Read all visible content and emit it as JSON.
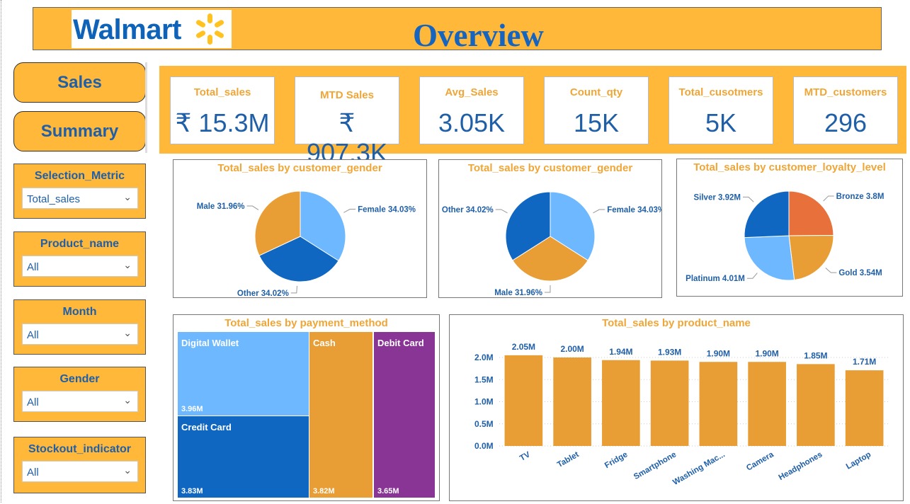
{
  "header": {
    "brand": "Walmart",
    "title": "Overview"
  },
  "nav": {
    "sales_label": "Sales",
    "summary_label": "Summary"
  },
  "slicers": [
    {
      "label": "Selection_Metric",
      "value": "Total_sales"
    },
    {
      "label": "Product_name",
      "value": "All"
    },
    {
      "label": "Month",
      "value": "All"
    },
    {
      "label": "Gender",
      "value": "All"
    },
    {
      "label": "Stockout_indicator",
      "value": "All"
    }
  ],
  "kpis": [
    {
      "label": "Total_sales",
      "value": "₹ 15.3M"
    },
    {
      "label": "MTD Sales",
      "value": "₹ 907.3K"
    },
    {
      "label": "Avg_Sales",
      "value": "3.05K"
    },
    {
      "label": "Count_qty",
      "value": "15K"
    },
    {
      "label": "Total_cusotmers",
      "value": "5K"
    },
    {
      "label": "MTD_customers",
      "value": "296"
    }
  ],
  "colors": {
    "accent": "#FFB83A",
    "brand_blue": "#1565C0",
    "title_orange": "#F0A637",
    "light_blue": "#6DB8FF",
    "dark_blue": "#0F67C2",
    "orange": "#E89D35",
    "purple": "#883596",
    "red_orange": "#E8703A"
  },
  "chart_data": [
    {
      "type": "pie",
      "title": "Total_sales by customer_gender",
      "slices": [
        {
          "label": "Female",
          "value": 34.03,
          "display": "Female 34.03%",
          "color": "#6DB8FF"
        },
        {
          "label": "Other",
          "value": 34.02,
          "display": "Other 34.02%",
          "color": "#0F67C2"
        },
        {
          "label": "Male",
          "value": 31.96,
          "display": "Male 31.96%",
          "color": "#E89D35"
        }
      ]
    },
    {
      "type": "pie",
      "title": "Total_sales by customer_gender",
      "slices": [
        {
          "label": "Female",
          "value": 34.03,
          "display": "Female 34.03%",
          "color": "#6DB8FF"
        },
        {
          "label": "Male",
          "value": 31.96,
          "display": "Male 31.96%",
          "color": "#E89D35"
        },
        {
          "label": "Other",
          "value": 34.02,
          "display": "Other 34.02%",
          "color": "#0F67C2"
        }
      ]
    },
    {
      "type": "pie",
      "title": "Total_sales by customer_loyalty_level",
      "slices": [
        {
          "label": "Bronze",
          "value": 3.8,
          "display": "Bronze 3.8M",
          "color": "#E8703A"
        },
        {
          "label": "Gold",
          "value": 3.54,
          "display": "Gold 3.54M",
          "color": "#E89D35"
        },
        {
          "label": "Platinum",
          "value": 4.01,
          "display": "Platinum 4.01M",
          "color": "#6DB8FF"
        },
        {
          "label": "Silver",
          "value": 3.92,
          "display": "Silver 3.92M",
          "color": "#0F67C2"
        }
      ]
    },
    {
      "type": "treemap",
      "title": "Total_sales by payment_method",
      "items": [
        {
          "label": "Digital Wallet",
          "value": 3.96,
          "display": "3.96M",
          "color": "#6DB8FF"
        },
        {
          "label": "Credit Card",
          "value": 3.83,
          "display": "3.83M",
          "color": "#0F67C2"
        },
        {
          "label": "Cash",
          "value": 3.82,
          "display": "3.82M",
          "color": "#E89D35"
        },
        {
          "label": "Debit Card",
          "value": 3.65,
          "display": "3.65M",
          "color": "#883596"
        }
      ]
    },
    {
      "type": "bar",
      "title": "Total_sales by product_name",
      "categories": [
        "TV",
        "Tablet",
        "Fridge",
        "Smartphone",
        "Washing Mac...",
        "Camera",
        "Headphones",
        "Laptop"
      ],
      "values": [
        2.05,
        2.0,
        1.94,
        1.93,
        1.9,
        1.9,
        1.85,
        1.71
      ],
      "data_labels": [
        "2.05M",
        "2.00M",
        "1.94M",
        "1.93M",
        "1.90M",
        "1.90M",
        "1.85M",
        "1.71M"
      ],
      "yticks": [
        "0.0M",
        "0.5M",
        "1.0M",
        "1.5M",
        "2.0M"
      ],
      "ylim": [
        0,
        2.0
      ],
      "color": "#E89D35"
    }
  ]
}
